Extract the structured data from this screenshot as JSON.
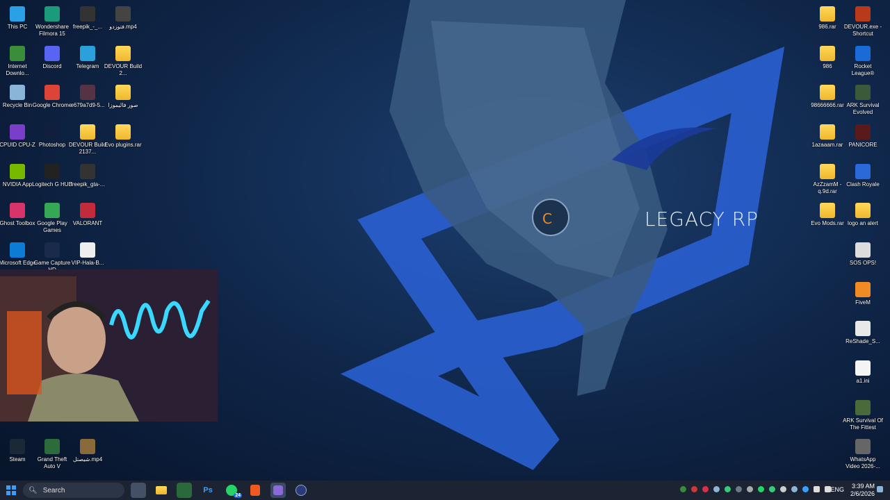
{
  "wallpaper": {
    "watermark_text": "LEGACY RP"
  },
  "desktop_icons": [
    {
      "label": "This PC",
      "icon": "computer-icon",
      "color": "#2aa0e6"
    },
    {
      "label": "Wondershare Filmora 15",
      "icon": "filmora-icon",
      "color": "#1a9c7a"
    },
    {
      "label": "freepik_-_...",
      "icon": "video-file-icon",
      "color": "#333333"
    },
    {
      "label": "فتوزدو.mp4",
      "icon": "video-file-icon",
      "color": "#444444"
    },
    {
      "label": "Internet Downlo...",
      "icon": "idm-icon",
      "color": "#3a8e3a"
    },
    {
      "label": "Discord",
      "icon": "discord-icon",
      "color": "#5865f2"
    },
    {
      "label": "Telegram",
      "icon": "telegram-icon",
      "color": "#2aa1da"
    },
    {
      "label": "DEVOUR Build 2...",
      "icon": "folder-icon",
      "color": "#f0b72c"
    },
    {
      "label": "Recycle Bin",
      "icon": "recycle-bin-icon",
      "color": "#8ab4d8"
    },
    {
      "label": "Google Chrome",
      "icon": "chrome-icon",
      "color": "#db4437"
    },
    {
      "label": "e679a7d9-5...",
      "icon": "image-file-icon",
      "color": "#553344"
    },
    {
      "label": "صور فاليموزا",
      "icon": "folder-icon",
      "color": "#f0b72c"
    },
    {
      "label": "CPUID CPU-Z",
      "icon": "cpuz-icon",
      "color": "#7a3ec8"
    },
    {
      "label": "Photoshop",
      "icon": "photoshop-icon",
      "color": "#0f1f3d"
    },
    {
      "label": "DEVOUR Build 2137...",
      "icon": "folder-icon",
      "color": "#f0b72c"
    },
    {
      "label": "Evo plugins.rar",
      "icon": "folder-icon",
      "color": "#f0b72c"
    },
    {
      "label": "NVIDIA App",
      "icon": "nvidia-icon",
      "color": "#76b900"
    },
    {
      "label": "Logitech G HUB",
      "icon": "logitech-icon",
      "color": "#222222"
    },
    {
      "label": "freepik_gta-...",
      "icon": "video-file-icon",
      "color": "#333333"
    },
    {
      "label": "Ghost Toolbox",
      "icon": "ghost-toolbox-icon",
      "color": "#d8336b"
    },
    {
      "label": "Google Play Games",
      "icon": "play-games-icon",
      "color": "#34a853"
    },
    {
      "label": "VALORANT",
      "icon": "valorant-icon",
      "color": "#c22b3b"
    },
    {
      "label": "Microsoft Edge",
      "icon": "edge-icon",
      "color": "#0c7cd5"
    },
    {
      "label": "Game Capture HD",
      "icon": "capture-icon",
      "color": "#1a2a4a"
    },
    {
      "label": "VIP-Hala-B...",
      "icon": "document-icon",
      "color": "#eeeeee"
    },
    {
      "label": "Steam",
      "icon": "steam-icon",
      "color": "#1b2838"
    },
    {
      "label": "Grand Theft Auto V",
      "icon": "gta-icon",
      "color": "#2c6b3a"
    },
    {
      "label": "شيصتل.mp4",
      "icon": "video-file-icon",
      "color": "#8a6a3a"
    },
    {
      "label": "986.rar",
      "icon": "folder-icon",
      "color": "#f0b72c"
    },
    {
      "label": "DEVOUR.exe - Shortcut",
      "icon": "devour-icon",
      "color": "#b83a1a"
    },
    {
      "label": "986",
      "icon": "folder-icon",
      "color": "#f0b72c"
    },
    {
      "label": "Rocket League®",
      "icon": "rocket-league-icon",
      "color": "#1a6ad8"
    },
    {
      "label": "98666666.rar",
      "icon": "folder-icon",
      "color": "#f0b72c"
    },
    {
      "label": "ARK Survival Evolved",
      "icon": "ark-icon",
      "color": "#3a5a3a"
    },
    {
      "label": "1azaaam.rar",
      "icon": "folder-icon",
      "color": "#f0b72c"
    },
    {
      "label": "PANICORE",
      "icon": "panicore-icon",
      "color": "#5a1a1a"
    },
    {
      "label": "AzZzamM - q.9d.rar",
      "icon": "folder-icon",
      "color": "#f0b72c"
    },
    {
      "label": "Clash Royale",
      "icon": "clash-royale-icon",
      "color": "#2a6ad8"
    },
    {
      "label": "Evo Mods.rar",
      "icon": "folder-icon",
      "color": "#f0b72c"
    },
    {
      "label": "logo an alert",
      "icon": "folder-icon",
      "color": "#f0b72c"
    },
    {
      "label": "SOS OPS!",
      "icon": "sos-ops-icon",
      "color": "#dddddd"
    },
    {
      "label": "FiveM",
      "icon": "fivem-icon",
      "color": "#f08a24"
    },
    {
      "label": "ReShade_S...",
      "icon": "reshade-icon",
      "color": "#e8e8e8"
    },
    {
      "label": "a1.ini",
      "icon": "ini-file-icon",
      "color": "#f4f4f4"
    },
    {
      "label": "ARK Survival Of The Fittest",
      "icon": "ark-icon",
      "color": "#4a6a3a"
    },
    {
      "label": "WhatsApp Video 2026-...",
      "icon": "video-file-icon",
      "color": "#666666"
    }
  ],
  "taskbar": {
    "search_placeholder": "Search",
    "whatsapp_badge": "24",
    "language": "ENG",
    "time": "3:39 AM",
    "date": "2/6/2026"
  }
}
